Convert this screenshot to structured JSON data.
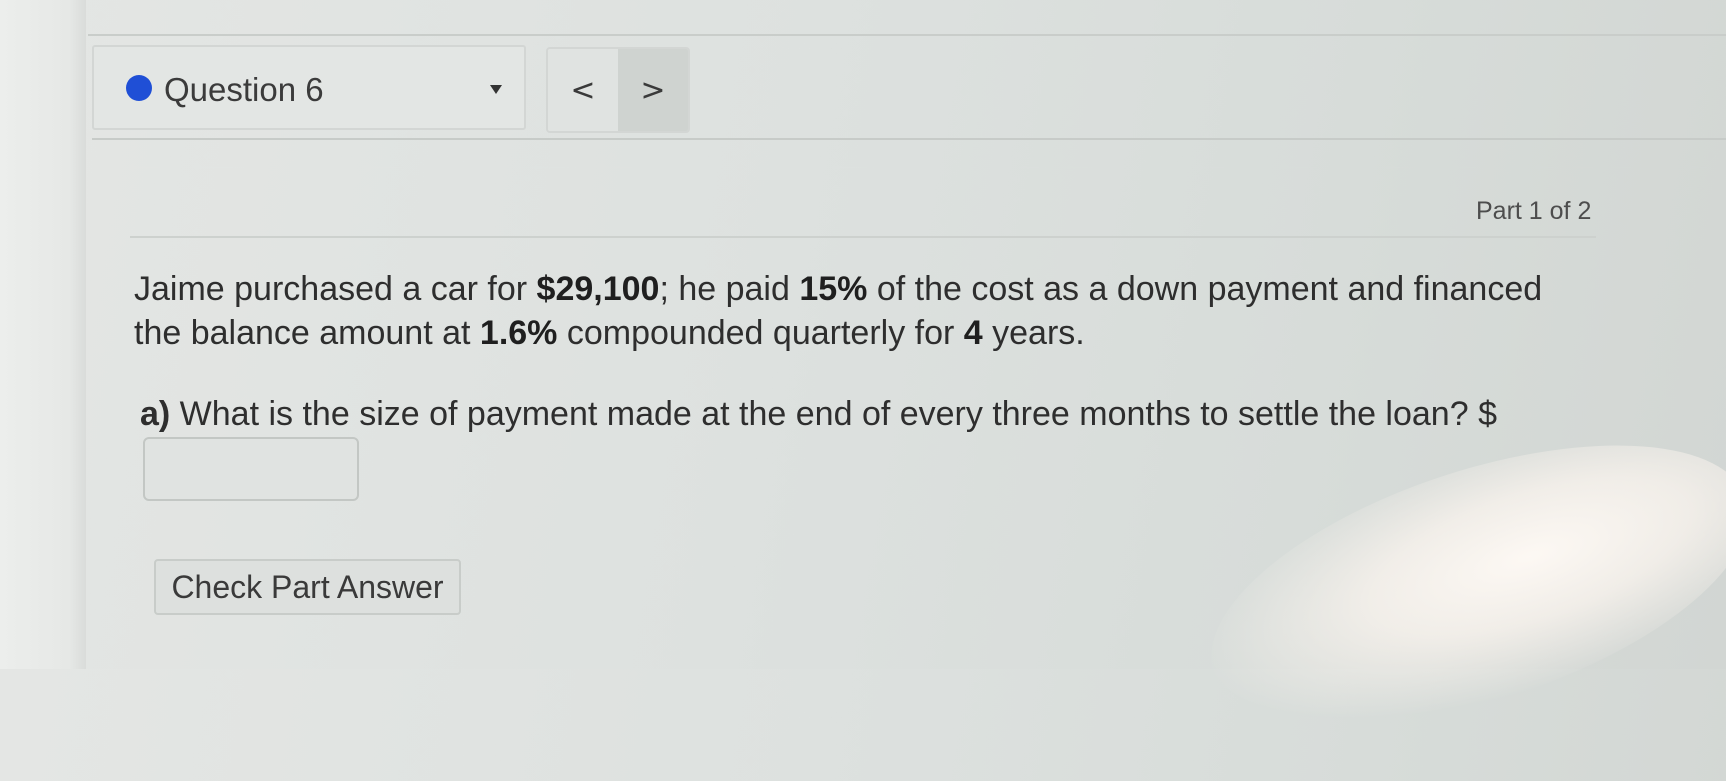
{
  "header": {
    "question_label": "Question 6",
    "dot_color": "#1f4fd6",
    "prev_label": "<",
    "next_label": ">"
  },
  "part": {
    "indicator": "Part 1 of 2"
  },
  "problem": {
    "t1": "Jaime purchased a car for ",
    "price": "$29,100",
    "t2": "; he paid ",
    "down_pct": "15%",
    "t3": " of the cost as a down payment and financed the balance amount at ",
    "rate": "1.6%",
    "t4": " compounded quarterly for ",
    "years": "4",
    "t5": " years."
  },
  "question_a": {
    "label": "a)",
    "text": " What is the size of payment made at the end of every three months to settle the loan? $"
  },
  "answer": {
    "value": ""
  },
  "actions": {
    "check_label": "Check Part Answer"
  }
}
